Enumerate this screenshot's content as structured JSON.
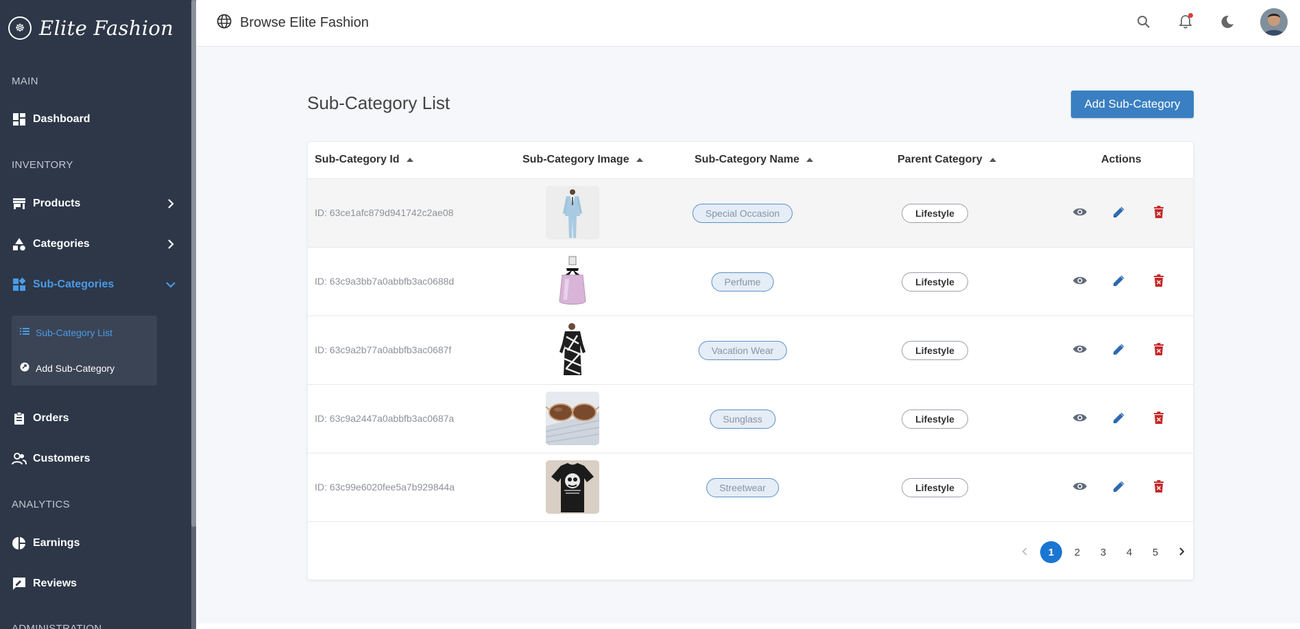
{
  "brand": {
    "name": "Elite Fashion"
  },
  "sidebar": {
    "sections": {
      "main": "MAIN",
      "inventory": "INVENTORY",
      "analytics": "ANALYTICS",
      "administration": "ADMINISTRATION"
    },
    "items": {
      "dashboard": "Dashboard",
      "products": "Products",
      "categories": "Categories",
      "subcategories": "Sub-Categories",
      "orders": "Orders",
      "customers": "Customers",
      "earnings": "Earnings",
      "reviews": "Reviews"
    },
    "submenu": {
      "list": "Sub-Category List",
      "add": "Add Sub-Category"
    }
  },
  "header": {
    "title": "Browse Elite Fashion"
  },
  "main": {
    "title": "Sub-Category List",
    "add_button": "Add Sub-Category",
    "columns": [
      "Sub-Category Id",
      "Sub-Category Image",
      "Sub-Category Name",
      "Parent Category",
      "Actions"
    ],
    "rows": [
      {
        "id": "ID: 63ce1afc879d941742c2ae08",
        "name": "Special Occasion",
        "parent": "Lifestyle",
        "image": "suit"
      },
      {
        "id": "ID: 63c9a3bb7a0abbfb3ac0688d",
        "name": "Perfume",
        "parent": "Lifestyle",
        "image": "perfume"
      },
      {
        "id": "ID: 63c9a2b77a0abbfb3ac0687f",
        "name": "Vacation Wear",
        "parent": "Lifestyle",
        "image": "dress"
      },
      {
        "id": "ID: 63c9a2447a0abbfb3ac0687a",
        "name": "Sunglass",
        "parent": "Lifestyle",
        "image": "sunglasses"
      },
      {
        "id": "ID: 63c99e6020fee5a7b929844a",
        "name": "Streetwear",
        "parent": "Lifestyle",
        "image": "tshirt"
      }
    ],
    "pagination": {
      "pages": [
        "1",
        "2",
        "3",
        "4",
        "5"
      ],
      "current": "1"
    }
  },
  "colors": {
    "sidebar_bg": "#2d3748",
    "accent": "#3a7fc1",
    "active_link": "#4b9be8",
    "delete": "#c62828"
  }
}
